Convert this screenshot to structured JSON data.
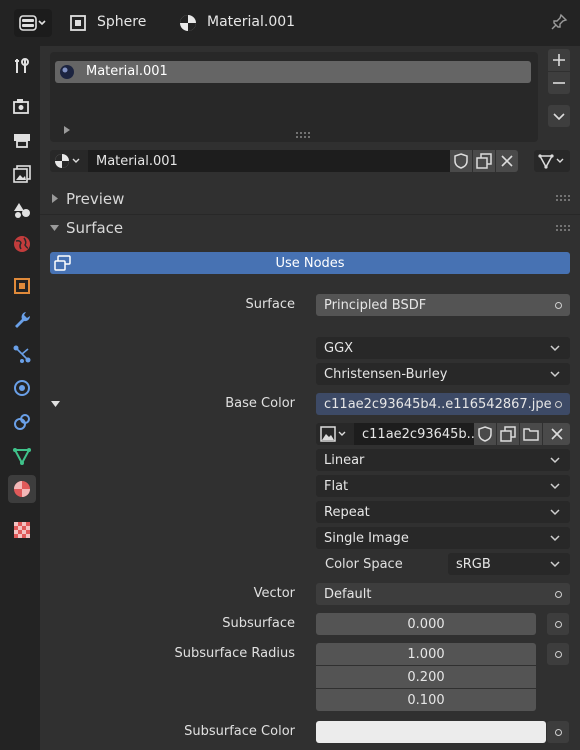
{
  "header": {
    "object_name": "Sphere",
    "material_name": "Material.001"
  },
  "sidebar": {
    "items": [
      {
        "name": "tool-icon"
      },
      {
        "name": "render-icon"
      },
      {
        "name": "output-icon"
      },
      {
        "name": "view-layer-icon"
      },
      {
        "name": "scene-icon"
      },
      {
        "name": "world-icon"
      },
      {
        "name": "object-icon"
      },
      {
        "name": "modifier-icon"
      },
      {
        "name": "particles-icon"
      },
      {
        "name": "physics-icon"
      },
      {
        "name": "constraints-icon"
      },
      {
        "name": "data-icon"
      },
      {
        "name": "material-icon"
      },
      {
        "name": "texture-icon"
      }
    ]
  },
  "slots": {
    "items": [
      "Material.001"
    ]
  },
  "material_selector": {
    "value": "Material.001"
  },
  "panels": {
    "preview": "Preview",
    "surface": "Surface"
  },
  "use_nodes": "Use Nodes",
  "props": {
    "surface_label": "Surface",
    "surface_value": "Principled BSDF",
    "distribution": "GGX",
    "subsurface_method": "Christensen-Burley",
    "base_color_label": "Base Color",
    "base_color_value": "c11ae2c93645b4..e116542867.jpe",
    "image_name": "c11ae2c93645b..",
    "interpolation": "Linear",
    "projection": "Flat",
    "extension": "Repeat",
    "source": "Single Image",
    "color_space_label": "Color Space",
    "color_space_value": "sRGB",
    "vector_label": "Vector",
    "vector_value": "Default",
    "subsurface_label": "Subsurface",
    "subsurface_value": "0.000",
    "subsurface_radius_label": "Subsurface Radius",
    "subsurface_radius": [
      "1.000",
      "0.200",
      "0.100"
    ],
    "subsurface_color_label": "Subsurface Color"
  },
  "colors": {
    "accent": "#4772b3",
    "background": "#303030",
    "field": "#545454"
  }
}
